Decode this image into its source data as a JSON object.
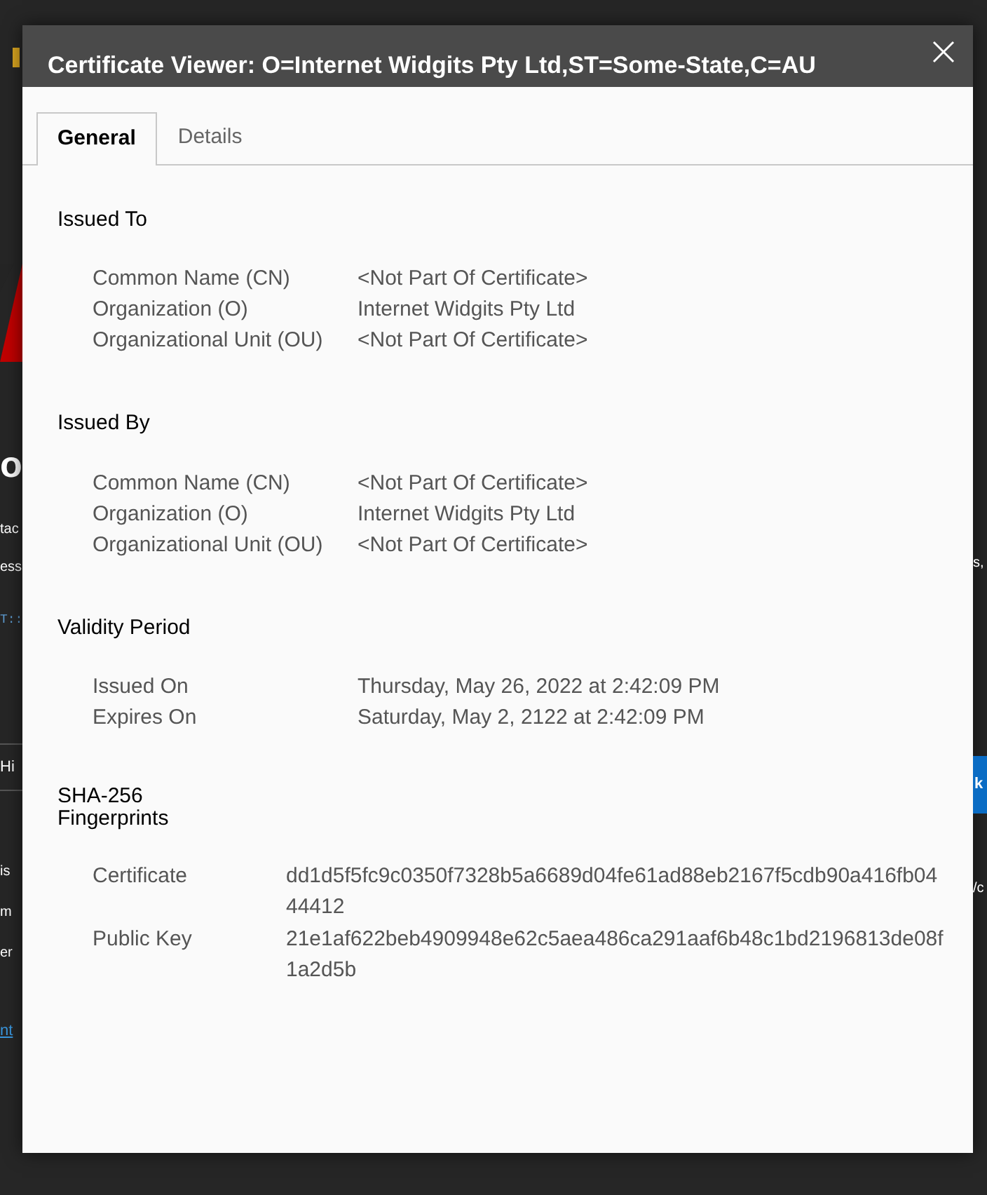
{
  "background": {
    "left": [
      {
        "kind": "icon"
      },
      {
        "kind": "shape"
      },
      {
        "kind": "heading",
        "text": "o"
      },
      {
        "kind": "text",
        "text": "tac"
      },
      {
        "kind": "text",
        "text": "ess"
      },
      {
        "kind": "code",
        "text": "T::"
      },
      {
        "kind": "button",
        "text": "Hi"
      },
      {
        "kind": "text",
        "text": "is"
      },
      {
        "kind": "text",
        "text": "m"
      },
      {
        "kind": "text",
        "text": "er"
      },
      {
        "kind": "link",
        "text": "nt"
      }
    ],
    "right": [
      {
        "kind": "text",
        "text": "s,"
      },
      {
        "kind": "primary",
        "text": "k"
      },
      {
        "kind": "text",
        "text": "/c"
      }
    ]
  },
  "dialog": {
    "title": "Certificate Viewer: O=Internet Widgits Pty Ltd,ST=Some-State,C=AU",
    "tabs": [
      {
        "label": "General",
        "selected": true
      },
      {
        "label": "Details",
        "selected": false
      }
    ],
    "sections": [
      {
        "kind": "info",
        "heading": "Issued To",
        "fields": [
          {
            "label": "Common Name (CN)",
            "value": "<Not Part Of Certificate>"
          },
          {
            "label": "Organization (O)",
            "value": "Internet Widgits Pty Ltd"
          },
          {
            "label": "Organizational Unit (OU)",
            "value": "<Not Part Of Certificate>"
          }
        ]
      },
      {
        "kind": "info",
        "heading": "Issued By",
        "fields": [
          {
            "label": "Common Name (CN)",
            "value": "<Not Part Of Certificate>"
          },
          {
            "label": "Organization (O)",
            "value": "Internet Widgits Pty Ltd"
          },
          {
            "label": "Organizational Unit (OU)",
            "value": "<Not Part Of Certificate>"
          }
        ]
      },
      {
        "kind": "info",
        "heading": "Validity Period",
        "fields": [
          {
            "label": "Issued On",
            "value": "Thursday, May 26, 2022 at 2:42:09 PM"
          },
          {
            "label": "Expires On",
            "value": "Saturday, May 2, 2122 at 2:42:09 PM"
          }
        ]
      },
      {
        "kind": "fingerprint",
        "heading": "SHA-256 Fingerprints",
        "fields": [
          {
            "label": "Certificate",
            "value": "dd1d5f5fc9c0350f7328b5a6689d04fe61ad88eb2167f5cdb90a416fb0444412"
          },
          {
            "label": "Public Key",
            "value": "21e1af622beb4909948e62c5aea486ca291aaf6b48c1bd2196813de08f1a2d5b"
          }
        ]
      }
    ]
  }
}
